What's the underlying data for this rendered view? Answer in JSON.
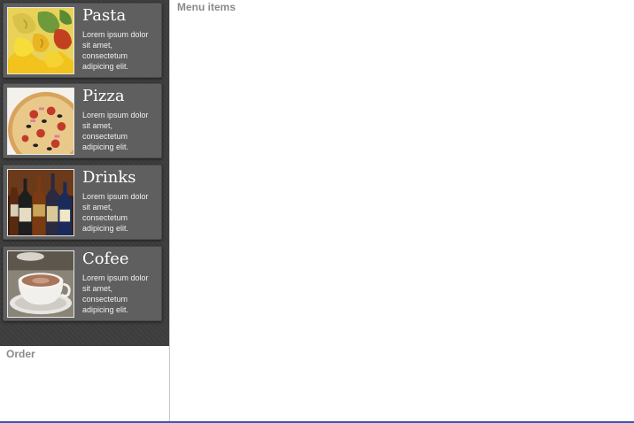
{
  "menu": {
    "categories": [
      {
        "title": "Pasta",
        "description": "Lorem ipsum dolor sit amet, consectetum adipicing elit."
      },
      {
        "title": "Pizza",
        "description": "Lorem ipsum dolor sit amet, consectetum adipicing elit."
      },
      {
        "title": "Drinks",
        "description": "Lorem ipsum dolor sit amet, consectetum adipicing elit."
      },
      {
        "title": "Cofee",
        "description": "Lorem ipsum dolor sit amet, consectetum adipicing elit."
      }
    ]
  },
  "order": {
    "label": "Order"
  },
  "main": {
    "label": "Menu items"
  },
  "colors": {
    "sidebar_bg": "#3d3d3d",
    "card_bg": "#5f5f5f",
    "section_label": "#8a8a8a",
    "bottom_accent": "#3f51b5"
  },
  "icons": {
    "pasta": "pasta-photo",
    "pizza": "pizza-photo",
    "drinks": "bottles-photo",
    "coffee": "coffee-cup-photo"
  }
}
